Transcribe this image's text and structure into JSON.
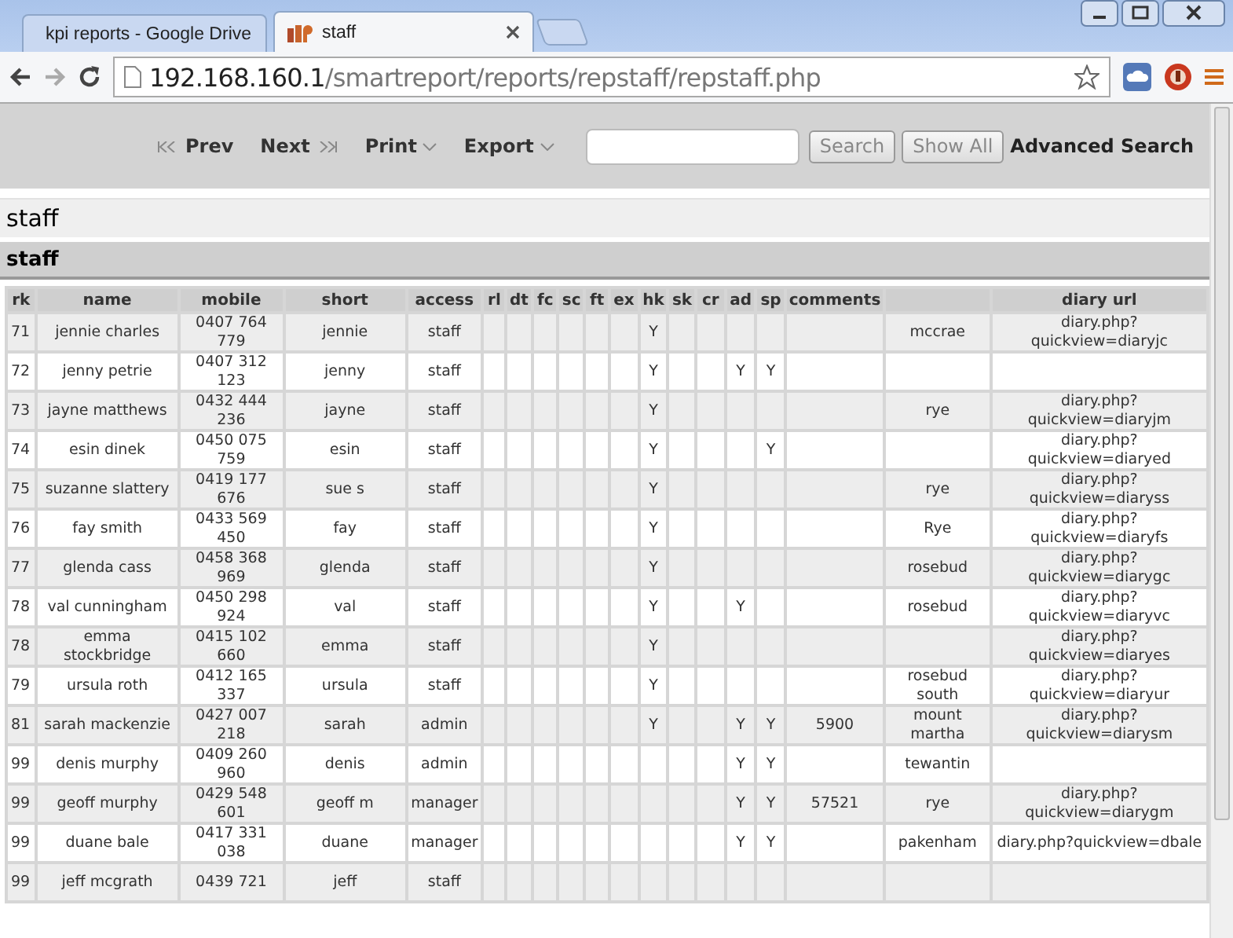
{
  "browser": {
    "tabs": [
      {
        "title": "kpi reports - Google Drive",
        "selected": false
      },
      {
        "title": "staff",
        "selected": true
      }
    ],
    "url_host": "192.168.160.1",
    "url_path": "/smartreport/reports/repstaff/repstaff.php"
  },
  "toolbar": {
    "prev": "Prev",
    "next": "Next",
    "print": "Print",
    "export": "Export",
    "search_button": "Search",
    "show_all_button": "Show All",
    "advanced_search": "Advanced Search"
  },
  "page_title": "staff",
  "section_title": "staff",
  "table": {
    "columns": [
      {
        "label": "rk"
      },
      {
        "label": "name"
      },
      {
        "label": "mobile"
      },
      {
        "label": "short"
      },
      {
        "label": "access"
      },
      {
        "label": "rl"
      },
      {
        "label": "dt"
      },
      {
        "label": "fc"
      },
      {
        "label": "sc"
      },
      {
        "label": "ft"
      },
      {
        "label": "ex"
      },
      {
        "label": "hk"
      },
      {
        "label": "sk"
      },
      {
        "label": "cr"
      },
      {
        "label": "ad"
      },
      {
        "label": "sp"
      },
      {
        "label": "comments"
      },
      {},
      {
        "label": "diary url"
      }
    ],
    "rows": [
      {
        "cells": [
          "71",
          "jennie charles",
          "0407 764 779",
          "jennie",
          "staff",
          null,
          null,
          null,
          null,
          null,
          null,
          "Y",
          null,
          null,
          null,
          null,
          null,
          "mccrae",
          "diary.php?quickview=diaryjc"
        ]
      },
      {
        "cells": [
          "72",
          "jenny petrie",
          "0407 312 123",
          "jenny",
          "staff",
          null,
          null,
          null,
          null,
          null,
          null,
          "Y",
          null,
          null,
          "Y",
          "Y",
          null,
          null,
          null
        ]
      },
      {
        "cells": [
          "73",
          "jayne matthews",
          "0432 444 236",
          "jayne",
          "staff",
          null,
          null,
          null,
          null,
          null,
          null,
          "Y",
          null,
          null,
          null,
          null,
          null,
          "rye",
          "diary.php?quickview=diaryjm"
        ]
      },
      {
        "cells": [
          "74",
          "esin dinek",
          "0450 075 759",
          "esin",
          "staff",
          null,
          null,
          null,
          null,
          null,
          null,
          "Y",
          null,
          null,
          null,
          "Y",
          null,
          null,
          "diary.php?quickview=diaryed"
        ]
      },
      {
        "cells": [
          "75",
          "suzanne slattery",
          "0419 177 676",
          "sue s",
          "staff",
          null,
          null,
          null,
          null,
          null,
          null,
          "Y",
          null,
          null,
          null,
          null,
          null,
          "rye",
          "diary.php?quickview=diaryss"
        ]
      },
      {
        "cells": [
          "76",
          "fay smith",
          "0433 569 450",
          "fay",
          "staff",
          null,
          null,
          null,
          null,
          null,
          null,
          "Y",
          null,
          null,
          null,
          null,
          null,
          "Rye",
          "diary.php?quickview=diaryfs"
        ]
      },
      {
        "cells": [
          "77",
          "glenda cass",
          "0458 368 969",
          "glenda",
          "staff",
          null,
          null,
          null,
          null,
          null,
          null,
          "Y",
          null,
          null,
          null,
          null,
          null,
          "rosebud",
          "diary.php?quickview=diarygc"
        ]
      },
      {
        "cells": [
          "78",
          "val cunningham",
          "0450 298 924",
          "val",
          "staff",
          null,
          null,
          null,
          null,
          null,
          null,
          "Y",
          null,
          null,
          "Y",
          null,
          null,
          "rosebud",
          "diary.php?quickview=diaryvc"
        ]
      },
      {
        "cells": [
          "78",
          "emma stockbridge",
          "0415 102 660",
          "emma",
          "staff",
          null,
          null,
          null,
          null,
          null,
          null,
          "Y",
          null,
          null,
          null,
          null,
          null,
          null,
          "diary.php?quickview=diaryes"
        ]
      },
      {
        "cells": [
          "79",
          "ursula roth",
          "0412 165 337",
          "ursula",
          "staff",
          null,
          null,
          null,
          null,
          null,
          null,
          "Y",
          null,
          null,
          null,
          null,
          null,
          "rosebud south",
          "diary.php?quickview=diaryur"
        ]
      },
      {
        "cells": [
          "81",
          "sarah mackenzie",
          "0427 007 218",
          "sarah",
          "admin",
          null,
          null,
          null,
          null,
          null,
          null,
          "Y",
          null,
          null,
          "Y",
          "Y",
          "5900",
          "mount martha",
          "diary.php?quickview=diarysm"
        ]
      },
      {
        "cells": [
          "99",
          "denis murphy",
          "0409 260 960",
          "denis",
          "admin",
          null,
          null,
          null,
          null,
          null,
          null,
          null,
          null,
          null,
          "Y",
          "Y",
          null,
          "tewantin",
          null
        ]
      },
      {
        "cells": [
          "99",
          "geoff murphy",
          "0429 548 601",
          "geoff m",
          "manager",
          null,
          null,
          null,
          null,
          null,
          null,
          null,
          null,
          null,
          "Y",
          "Y",
          "57521",
          "rye",
          "diary.php?quickview=diarygm"
        ]
      },
      {
        "cells": [
          "99",
          "duane bale",
          "0417 331 038",
          "duane",
          "manager",
          null,
          null,
          null,
          null,
          null,
          null,
          null,
          null,
          null,
          "Y",
          "Y",
          null,
          "pakenham",
          "diary.php?quickview=dbale"
        ]
      },
      {
        "cells": [
          "99",
          "jeff mcgrath",
          "0439 721",
          "jeff",
          "staff",
          null,
          null,
          null,
          null,
          null,
          null,
          null,
          null,
          null,
          null,
          null,
          null,
          null,
          null
        ]
      }
    ]
  }
}
